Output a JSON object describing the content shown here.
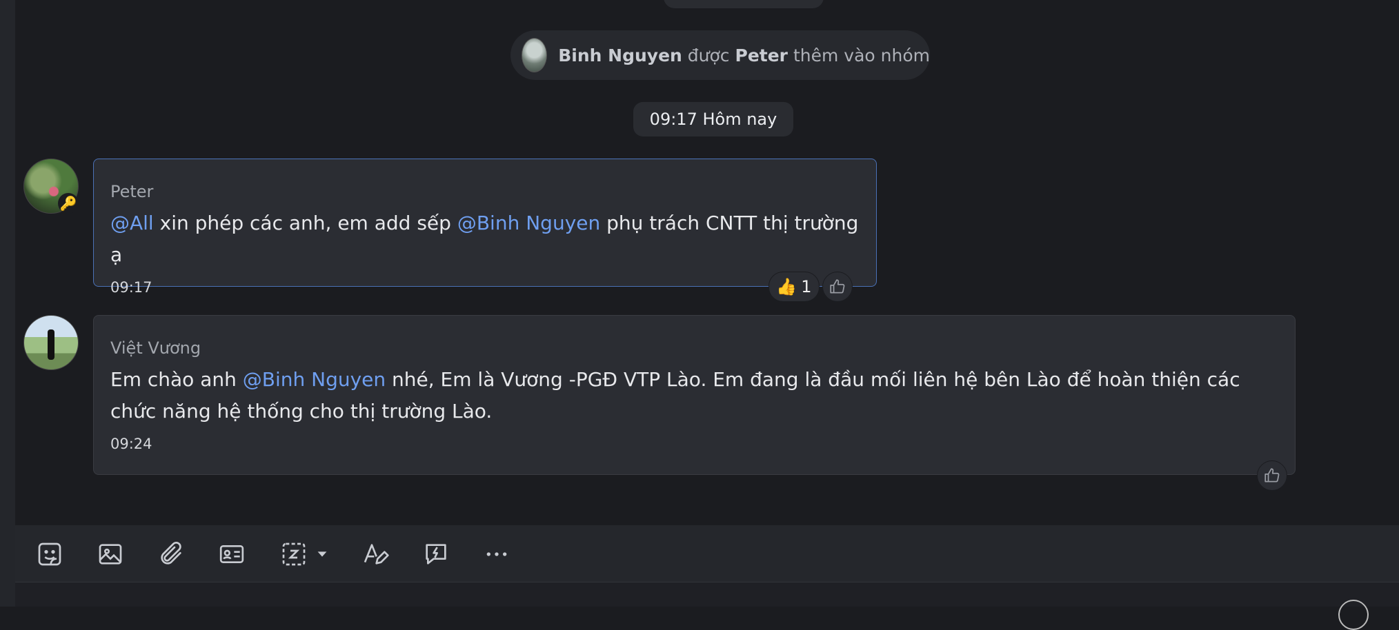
{
  "system_message": {
    "added_user": "Binh Nguyen",
    "verb": "được",
    "adder": "Peter",
    "suffix": "thêm vào nhóm"
  },
  "time_divider": "09:17 Hôm nay",
  "messages": [
    {
      "sender": "Peter",
      "parts": {
        "m1": "@All",
        "t1": " xin phép các anh, em add sếp ",
        "m2": "@Binh Nguyen",
        "t2": " phụ trách CNTT thị trường ạ"
      },
      "time": "09:17",
      "reaction": {
        "emoji": "👍",
        "count": "1"
      }
    },
    {
      "sender": "Việt Vương",
      "parts": {
        "t1": "Em chào anh ",
        "m1": "@Binh Nguyen",
        "t2": " nhé, Em là Vương -PGĐ VTP Lào. Em đang là đầu mối liên hệ bên Lào để hoàn thiện các chức năng hệ thống cho thị trường Lào."
      },
      "time": "09:24"
    }
  ],
  "toolbar": {
    "icons": [
      "emoji-sticker-icon",
      "image-icon",
      "attach-icon",
      "contact-card-icon",
      "screenshot-icon",
      "dropdown-icon",
      "format-text-icon",
      "quick-message-icon",
      "more-icon"
    ]
  },
  "colors": {
    "background": "#1b1c20",
    "bubble": "#2b2d33",
    "mention": "#6f9ff0",
    "highlight_border": "#4b72b8"
  }
}
